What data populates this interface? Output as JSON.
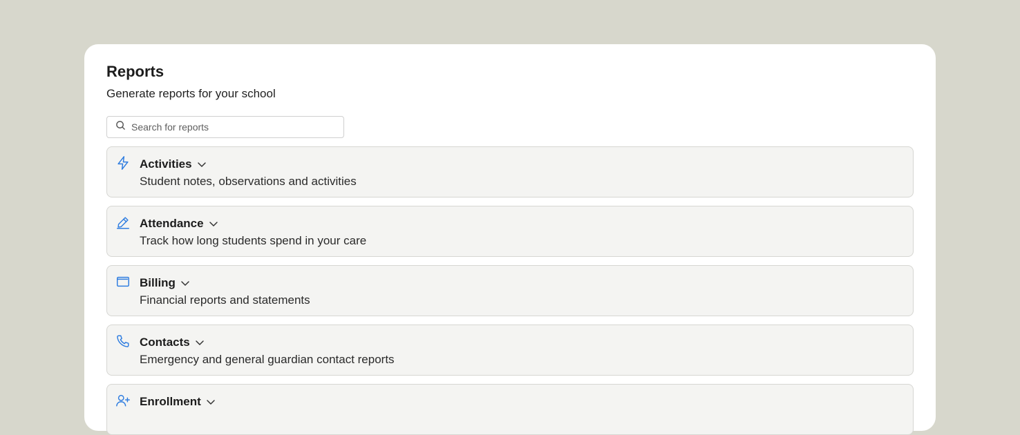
{
  "colors": {
    "background": "#d7d7cc",
    "card": "#ffffff",
    "accent_icon": "#2f7de0",
    "item_background": "#f4f4f2"
  },
  "header": {
    "title": "Reports",
    "subtitle": "Generate reports for your school"
  },
  "search": {
    "placeholder": "Search for reports",
    "value": "",
    "icon": "search-icon"
  },
  "reports": [
    {
      "title": "Activities",
      "description": "Student notes, observations and activities",
      "icon": "lightning-icon"
    },
    {
      "title": "Attendance",
      "description": "Track how long students spend in your care",
      "icon": "pencil-icon"
    },
    {
      "title": "Billing",
      "description": "Financial reports and statements",
      "icon": "wallet-icon"
    },
    {
      "title": "Contacts",
      "description": "Emergency and general guardian contact reports",
      "icon": "phone-icon"
    },
    {
      "title": "Enrollment",
      "description": "",
      "icon": "user-plus-icon"
    }
  ]
}
